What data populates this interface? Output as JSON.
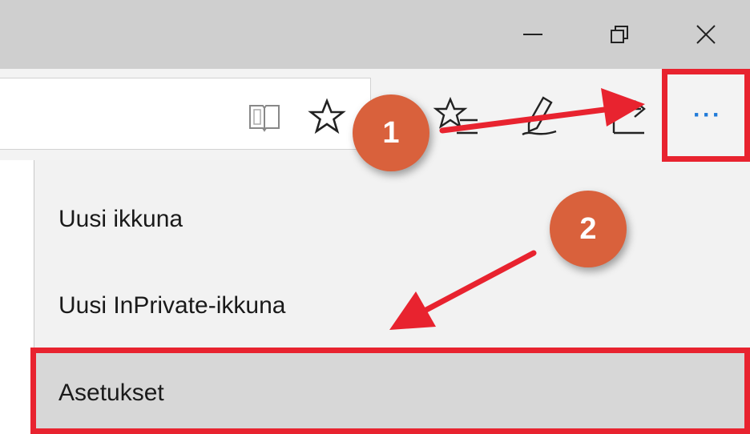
{
  "window_controls": {
    "minimize_icon": "minimize-icon",
    "restore_icon": "restore-icon",
    "close_icon": "close-icon"
  },
  "toolbar": {
    "icons": [
      "reading-view-icon",
      "favorite-star-icon",
      "favorites-hub-icon",
      "web-note-icon",
      "share-icon"
    ],
    "more_button_label": "···"
  },
  "menu": {
    "items": [
      {
        "label": "Uusi ikkuna"
      },
      {
        "label": "Uusi InPrivate-ikkuna"
      },
      {
        "label": "Asetukset"
      }
    ]
  },
  "annotations": {
    "step1": "1",
    "step2": "2",
    "highlight_color": "#e8232f",
    "badge_color": "#d9613c"
  }
}
